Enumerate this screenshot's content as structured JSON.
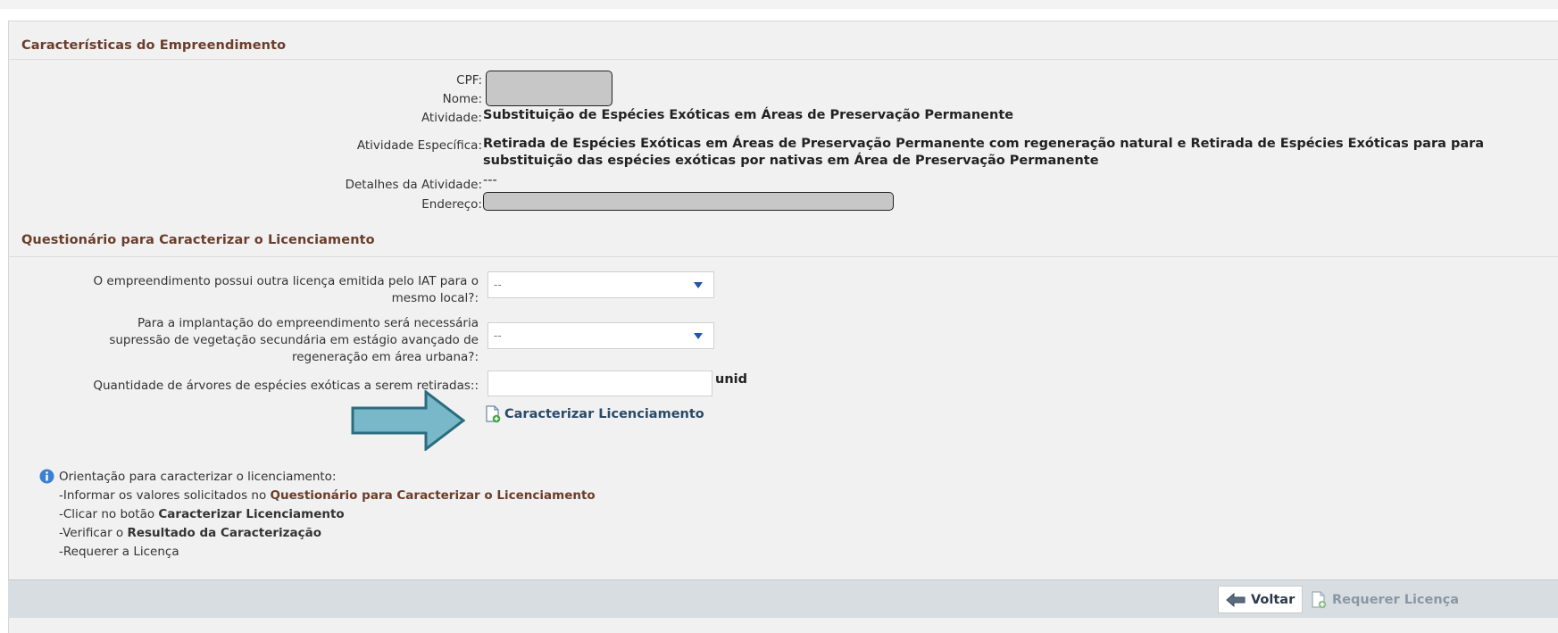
{
  "empreendimento": {
    "title": "Características do Empreendimento",
    "fields": {
      "cpf_label": "CPF:",
      "nome_label": "Nome:",
      "atividade_label": "Atividade:",
      "atividade_value": "Substituição de Espécies Exóticas em Áreas de Preservação Permanente",
      "atividade_especifica_label": "Atividade Específica:",
      "atividade_especifica_line1": "Retirada de Espécies Exóticas em Áreas de Preservação Permanente com regeneração natural e Retirada de Espécies Exóticas para para",
      "atividade_especifica_line2": "substituição das espécies exóticas por nativas em Área de Preservação Permanente",
      "detalhes_label": "Detalhes da Atividade:",
      "detalhes_value": "---",
      "endereco_label": "Endereço:"
    }
  },
  "questionario": {
    "title": "Questionário para Caracterizar o Licenciamento",
    "q1_line1": "O empreendimento possui outra licença emitida pelo IAT para o",
    "q1_line2": "mesmo local?:",
    "q1_value": "--",
    "q2_line1": "Para a implantação do empreendimento será necessária",
    "q2_line2": "supressão de vegetação secundária em estágio avançado de",
    "q2_line3": "regeneração em área urbana?:",
    "q2_value": "--",
    "q3_label": "Quantidade de árvores de espécies exóticas a serem retiradas::",
    "q3_value": "",
    "q3_unit": "unid",
    "caracterizar_button": "Caracterizar Licenciamento"
  },
  "orientacao": {
    "heading": "Orientação para caracterizar o licenciamento:",
    "step1_prefix": "-Informar os valores solicitados no ",
    "step1_bold": "Questionário para Caracterizar o Licenciamento",
    "step2_prefix": "-Clicar no botão ",
    "step2_bold": "Caracterizar Licenciamento",
    "step3_prefix": "-Verificar o ",
    "step3_bold": "Resultado da Caracterização",
    "step4": "-Requerer a Licença"
  },
  "footer": {
    "voltar_label": "Voltar",
    "requerer_label": "Requerer Licença"
  },
  "colors": {
    "section_title": "#6b3d2a",
    "annotation_arrow": "#79b8c8",
    "annotation_outline": "#2b6d80",
    "footer_bg": "#d8dde2"
  }
}
